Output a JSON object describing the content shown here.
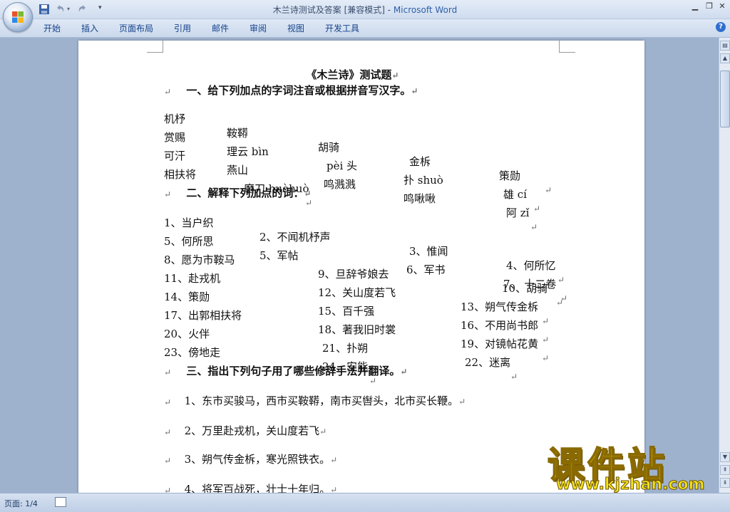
{
  "window": {
    "doc_title": "木兰诗测试及答案 [兼容模式] - ",
    "app_name": "Microsoft Word"
  },
  "ribbon": {
    "tabs": [
      "开始",
      "插入",
      "页面布局",
      "引用",
      "邮件",
      "审阅",
      "视图",
      "开发工具"
    ]
  },
  "document": {
    "title": "《木兰诗》测试题",
    "section1": "一、给下列加点的字词注音或根据拼音写汉字。",
    "s1_rows": [
      [
        "机杼",
        "鞍鞯",
        "胡骑",
        "金柝",
        "策勋"
      ],
      [
        "赏赐",
        "理云 bìn",
        "pèi 头",
        "扑 shuò",
        "雄 cí"
      ],
      [
        "可汗",
        "燕山",
        "鸣溅溅",
        "鸣啾啾",
        "阿 zǐ"
      ],
      [
        "相扶将",
        "磨刀 huòhuò",
        "",
        "",
        ""
      ]
    ],
    "section2": "二、解释下列加点的词：",
    "s2_rows": [
      [
        "1、当户织",
        "2、不闻机杼声",
        "3、惟闻",
        "4、何所忆"
      ],
      [
        "5、何所思",
        "5、军帖",
        "6、军书",
        "7、 十二卷"
      ],
      [
        "8、愿为市鞍马",
        "9、旦辞爷娘去",
        "10、胡骑",
        ""
      ],
      [
        "11、赴戎机",
        "12、关山度若飞",
        "13、朔气传金柝",
        ""
      ],
      [
        "14、策勋",
        "15、百千强",
        "16、不用尚书郎",
        ""
      ],
      [
        "17、出郭相扶将",
        "18、著我旧时裳",
        "19、对镜帖花黄",
        ""
      ],
      [
        "20、火伴",
        "21、扑朔",
        "22、迷离",
        ""
      ],
      [
        "23、傍地走",
        "24、安能",
        "",
        ""
      ]
    ],
    "section3": "三、指出下列句子用了哪些修辞手法并翻译。",
    "s3_items": [
      "1、东市买骏马，西市买鞍鞯，南市买辔头，北市买长鞭。",
      "2、万里赴戎机，关山度若飞",
      "3、朔气传金柝，寒光照铁衣。",
      "4、将军百战死，壮士十年归。"
    ],
    "para_mark": "↵"
  },
  "statusbar": {
    "page": "页面: 1/4"
  },
  "watermark": {
    "text": "课件站",
    "url": "www.kjzhan.com"
  }
}
